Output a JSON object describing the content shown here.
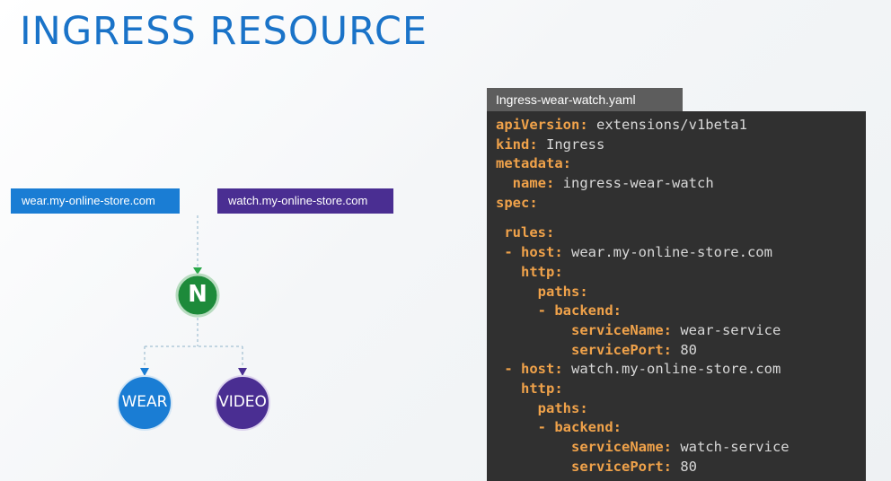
{
  "title": "INGRESS RESOURCE",
  "hosts": {
    "wear": "wear.my-online-store.com",
    "watch": "watch.my-online-store.com"
  },
  "nodes": {
    "ingress": "N",
    "wear": "WEAR",
    "video": "VIDEO"
  },
  "colors": {
    "title": "#1a73c8",
    "wear_blue": "#1a7dd4",
    "watch_purple": "#4a2e92",
    "ingress_green": "#1d8a3a",
    "code_bg": "#303030",
    "code_key": "#f0a24a"
  },
  "file": {
    "name": "Ingress-wear-watch.yaml",
    "lines": [
      {
        "indent": "",
        "key": "apiVersion:",
        "value": " extensions/v1beta1"
      },
      {
        "indent": "",
        "key": "kind:",
        "value": " Ingress"
      },
      {
        "indent": "",
        "key": "metadata:",
        "value": ""
      },
      {
        "indent": "  ",
        "key": "name:",
        "value": " ingress-wear-watch"
      },
      {
        "indent": "",
        "key": "spec:",
        "value": ""
      },
      {
        "indent": " ",
        "key": "rules:",
        "value": "",
        "gap_before": true
      },
      {
        "indent": " - ",
        "key": "host:",
        "value": " wear.my-online-store.com"
      },
      {
        "indent": "   ",
        "key": "http:",
        "value": ""
      },
      {
        "indent": "     ",
        "key": "paths:",
        "value": ""
      },
      {
        "indent": "     - ",
        "key": "backend:",
        "value": ""
      },
      {
        "indent": "         ",
        "key": "serviceName:",
        "value": " wear-service"
      },
      {
        "indent": "         ",
        "key": "servicePort:",
        "value": " 80"
      },
      {
        "indent": " - ",
        "key": "host:",
        "value": " watch.my-online-store.com"
      },
      {
        "indent": "   ",
        "key": "http:",
        "value": ""
      },
      {
        "indent": "     ",
        "key": "paths:",
        "value": ""
      },
      {
        "indent": "     - ",
        "key": "backend:",
        "value": ""
      },
      {
        "indent": "         ",
        "key": "serviceName:",
        "value": " watch-service"
      },
      {
        "indent": "         ",
        "key": "servicePort:",
        "value": " 80"
      }
    ]
  }
}
